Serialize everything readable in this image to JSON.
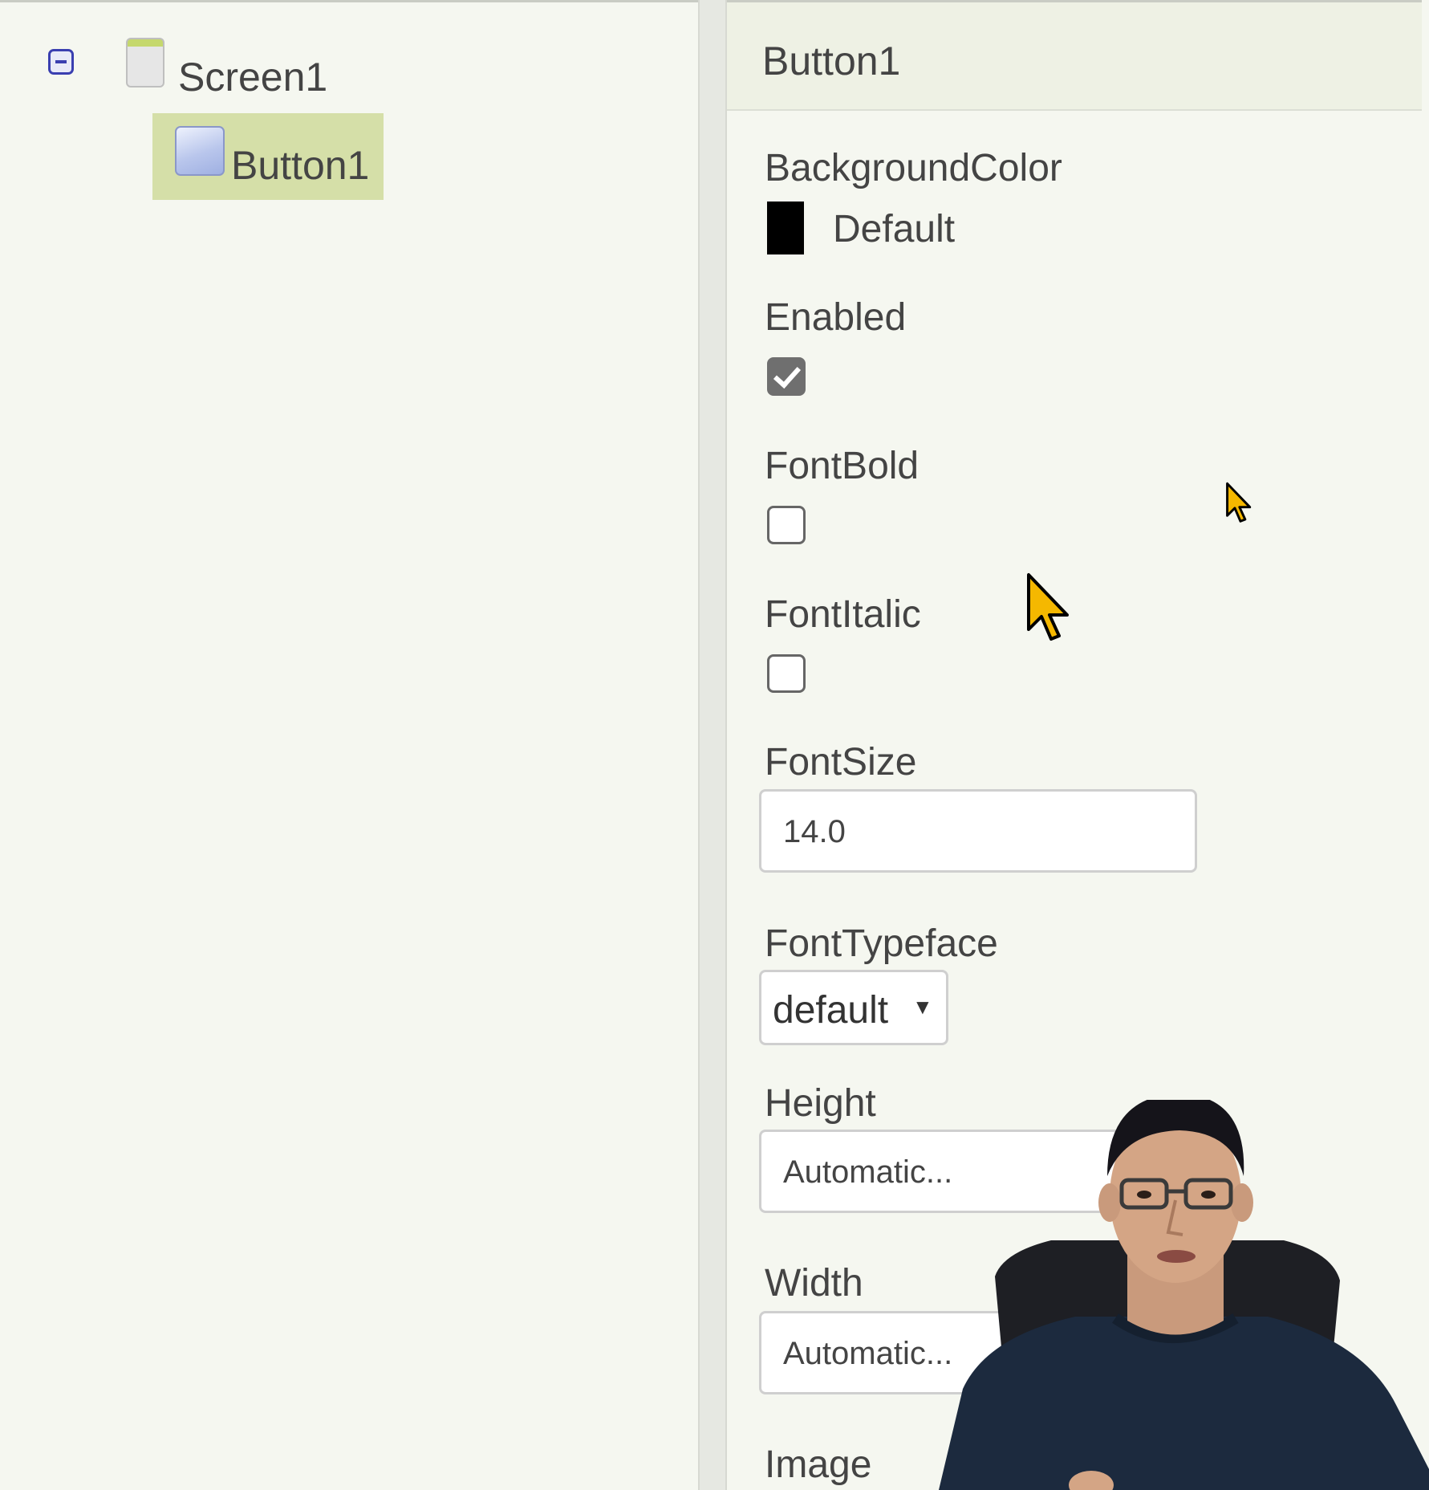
{
  "tree": {
    "root_label": "Screen1",
    "child_label": "Button1"
  },
  "properties": {
    "title": "Button1",
    "background_color": {
      "label": "BackgroundColor",
      "value": "Default",
      "swatch": "#000000"
    },
    "enabled": {
      "label": "Enabled",
      "checked": true
    },
    "font_bold": {
      "label": "FontBold",
      "checked": false
    },
    "font_italic": {
      "label": "FontItalic",
      "checked": false
    },
    "font_size": {
      "label": "FontSize",
      "value": "14.0"
    },
    "font_typeface": {
      "label": "FontTypeface",
      "value": "default"
    },
    "height": {
      "label": "Height",
      "value": "Automatic..."
    },
    "width": {
      "label": "Width",
      "value": "Automatic..."
    },
    "image": {
      "label": "Image"
    }
  },
  "icons": {
    "collapse": "collapse-minus-icon",
    "screen": "screen-icon",
    "button": "button-icon",
    "dropdown": "dropdown-arrow-icon",
    "cursor": "mouse-pointer-icon"
  },
  "colors": {
    "selection": "#d5dfa8",
    "panel_bg": "#f5f7f0",
    "header_bg": "#eef1e4",
    "cursor": "#f5b800"
  }
}
